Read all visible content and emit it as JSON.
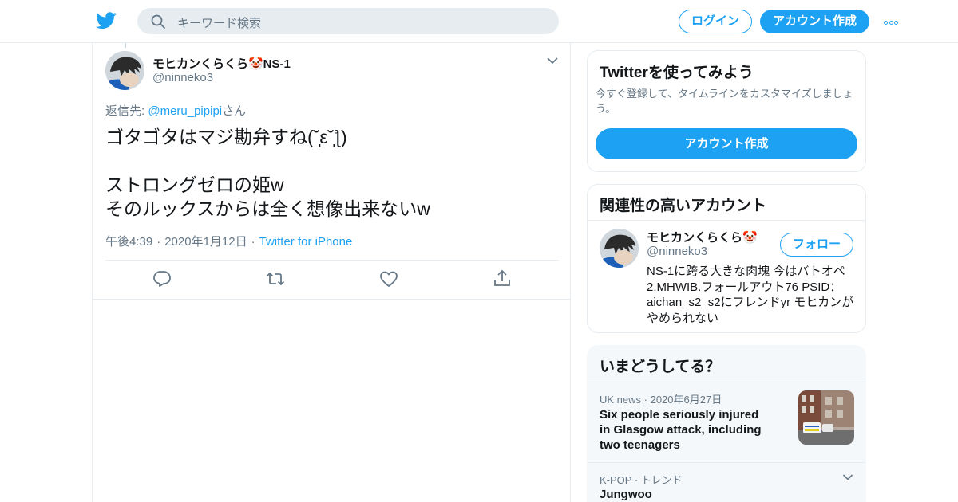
{
  "header": {
    "search_placeholder": "キーワード検索",
    "login_label": "ログイン",
    "signup_label": "アカウント作成"
  },
  "tweet": {
    "display_name": "モヒカンくらくら🤡NS-1",
    "handle": "@ninneko3",
    "reply_prefix": "返信先: ",
    "reply_handle": "@meru_pipipi",
    "reply_suffix": "さん",
    "text": "ゴタゴタはマジ勘弁すね(˘̩̩̩ε˘̩ƪ)\n\nストロングゼロの姫w\nそのルックスからは全く想像出来ないw",
    "time": "午後4:39",
    "date": "2020年1月12日",
    "source": "Twitter for iPhone"
  },
  "sidebar": {
    "signup_card": {
      "title": "Twitterを使ってみよう",
      "desc": "今すぐ登録して、タイムラインをカスタマイズしましょう。",
      "cta": "アカウント作成"
    },
    "related": {
      "title": "関連性の高いアカウント",
      "name": "モヒカンくらくら🤡",
      "handle": "@ninneko3",
      "follow_label": "フォロー",
      "bio": "NS-1に跨る大きな肉塊 今はバトオペ2.MHWIB.フォールアウト76 PSID：aichan_s2_s2にフレンドyr モヒカンがやめられない"
    },
    "trends": {
      "title": "いまどうしてる？",
      "items": [
        {
          "category": "UK news",
          "date": "2020年6月27日",
          "title": "Six people seriously injured in Glasgow attack, including two teenagers"
        },
        {
          "category": "K-POP",
          "date": "トレンド",
          "title": "Jungwoo"
        }
      ]
    }
  },
  "colors": {
    "brand": "#1da1f2",
    "secondary_text": "#657786",
    "border": "#e6ecf0"
  }
}
